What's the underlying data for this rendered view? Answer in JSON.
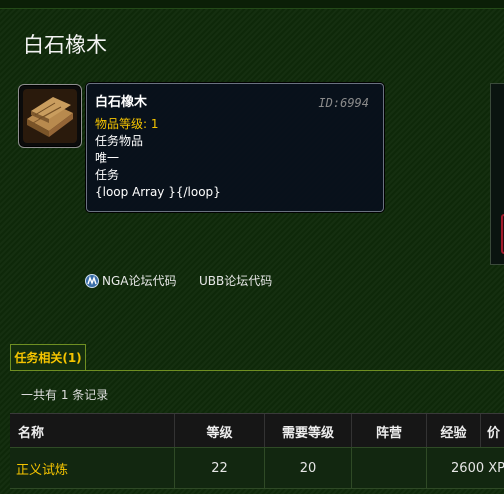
{
  "page": {
    "title": "白石橡木"
  },
  "item": {
    "name": "白石橡木",
    "id_text": "ID:6994",
    "level_text": "物品等级: 1",
    "lines": [
      "任务物品",
      "唯一",
      "任务",
      "{loop Array }{/loop}"
    ],
    "icon": "wooden-planks-icon"
  },
  "codes": {
    "nga": "NGA论坛代码",
    "ubb": "UBB论坛代码"
  },
  "tabs": [
    {
      "label": "任务相关(1)",
      "active": true
    }
  ],
  "record_count": "一共有 1 条记录",
  "table": {
    "headers": {
      "name": "名称",
      "level": "等级",
      "req_level": "需要等级",
      "faction": "阵营",
      "xp": "经验",
      "price": "价"
    },
    "rows": [
      {
        "name": "正义试炼",
        "level": "22",
        "req_level": "20",
        "faction": "",
        "xp": "2600 XP"
      }
    ]
  },
  "colors": {
    "quest_gold": "#f5c400",
    "background": "#0f2a0a",
    "tab_border": "#6f8f22"
  }
}
